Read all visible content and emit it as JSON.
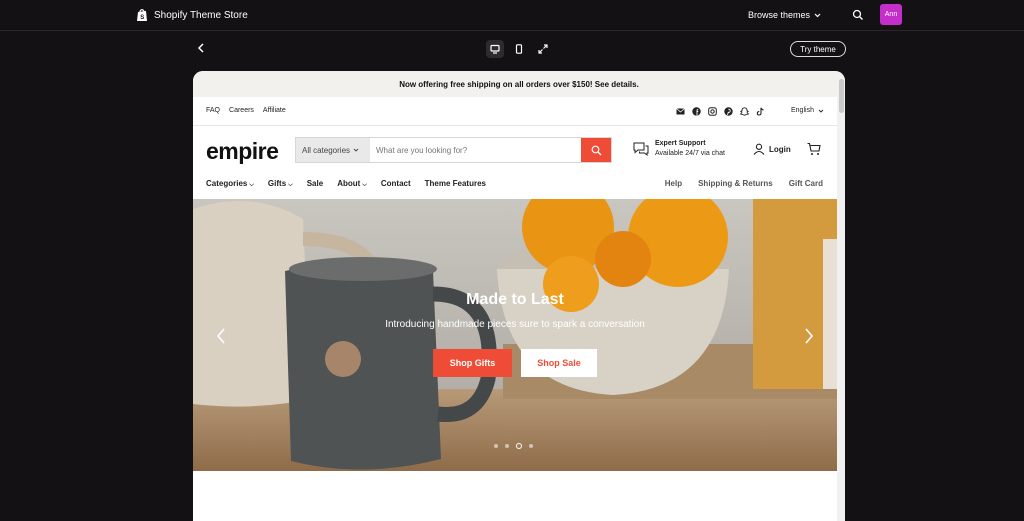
{
  "app": {
    "title": "Shopify Theme Store",
    "browse_label": "Browse themes",
    "avatar_initials": "Ann",
    "avatar_color": "#c42fcc",
    "try_label": "Try theme"
  },
  "preview_controls": {
    "devices": [
      "desktop-icon",
      "mobile-icon",
      "fullscreen-icon"
    ],
    "active_device": "desktop"
  },
  "store": {
    "announcement": "Now offering free shipping on all orders over $150! See details.",
    "utility_links": [
      "FAQ",
      "Careers",
      "Affiliate"
    ],
    "social_icons": [
      "email-icon",
      "facebook-icon",
      "instagram-icon",
      "pinterest-icon",
      "snapchat-icon",
      "tiktok-icon"
    ],
    "language": "English",
    "logo": "empire",
    "search": {
      "category": "All categories",
      "placeholder": "What are you looking for?"
    },
    "support": {
      "title": "Expert Support",
      "subtitle": "Available 24/7 via chat"
    },
    "login_label": "Login",
    "nav_left": [
      {
        "label": "Categories",
        "dropdown": true
      },
      {
        "label": "Gifts",
        "dropdown": true
      },
      {
        "label": "Sale",
        "dropdown": false
      },
      {
        "label": "About",
        "dropdown": true
      },
      {
        "label": "Contact",
        "dropdown": false
      },
      {
        "label": "Theme Features",
        "dropdown": false
      }
    ],
    "nav_right": [
      "Help",
      "Shipping & Returns",
      "Gift Card"
    ],
    "hero": {
      "title": "Made to Last",
      "subtitle": "Introducing handmade pieces sure to spark a conversation",
      "primary_button": "Shop Gifts",
      "secondary_button": "Shop Sale",
      "slide_count": 4,
      "active_slide": 3
    },
    "accent_color": "#ef4c37"
  }
}
